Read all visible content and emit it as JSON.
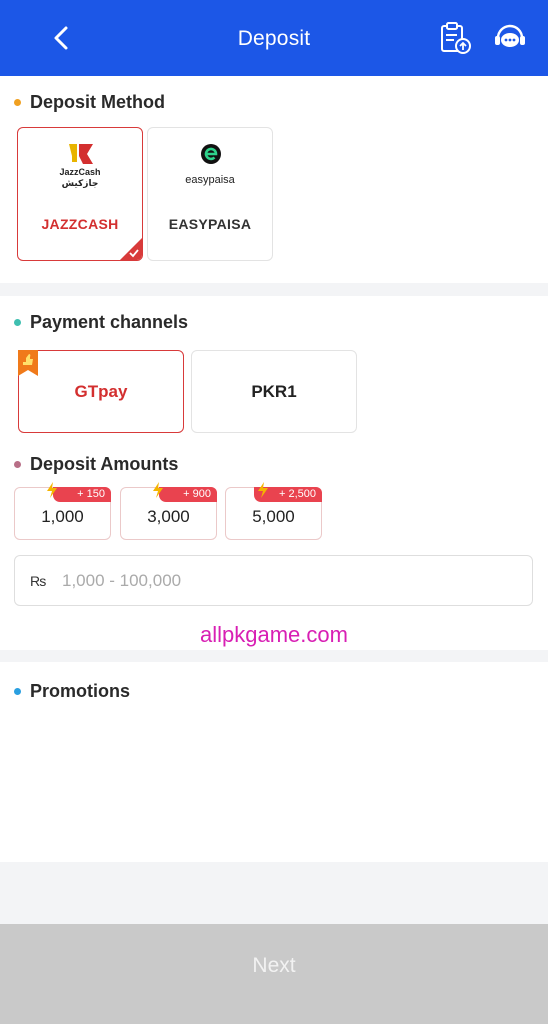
{
  "header": {
    "title": "Deposit",
    "back_icon": "chevron-left-icon",
    "records_icon": "clipboard-upload-icon",
    "support_icon": "headset-chat-icon"
  },
  "deposit_method": {
    "title": "Deposit Method",
    "dot_color": "#f0a020",
    "methods": [
      {
        "label": "JAZZCASH",
        "logo_text_1": "JazzCash",
        "logo_text_2": "جازکیش",
        "selected": true
      },
      {
        "label": "EASYPAISA",
        "logo_text": "easypaisa",
        "selected": false
      }
    ]
  },
  "payment_channels": {
    "title": "Payment channels",
    "dot_color": "#3fbfb0",
    "channels": [
      {
        "label": "GTpay",
        "selected": true,
        "recommended": true
      },
      {
        "label": "PKR1",
        "selected": false
      }
    ]
  },
  "deposit_amounts": {
    "title": "Deposit Amounts",
    "dot_color": "#b86f87",
    "options": [
      {
        "value": "1,000",
        "bonus": "+ 150"
      },
      {
        "value": "3,000",
        "bonus": "+ 900"
      },
      {
        "value": "5,000",
        "bonus": "+ 2,500"
      }
    ],
    "input": {
      "currency": "₨",
      "placeholder": "1,000 - 100,000",
      "value": ""
    }
  },
  "watermark": "allpkgame.com",
  "promotions": {
    "title": "Promotions",
    "dot_color": "#2a9fe0"
  },
  "footer": {
    "next_label": "Next"
  },
  "colors": {
    "header_bg": "#1c57e7",
    "accent_red": "#d83a3a",
    "next_disabled_bg": "#c9c9c9"
  }
}
